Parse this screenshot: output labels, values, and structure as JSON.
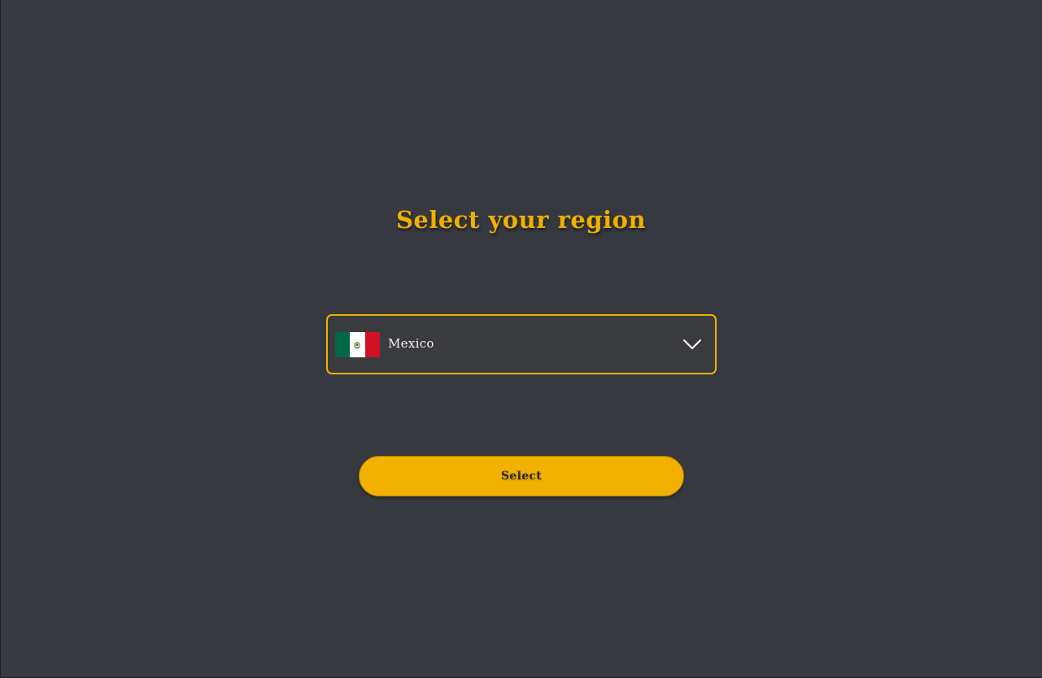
{
  "page": {
    "title": "Select your region"
  },
  "region_select": {
    "selected_country": "Mexico",
    "selected_flag": "mexico-flag-icon",
    "dropdown_icon": "chevron-down-icon"
  },
  "actions": {
    "select_label": "Select"
  },
  "colors": {
    "background": "#363940",
    "accent": "#f0b000",
    "dropdown_bg": "#3a3b3e",
    "text_light": "#f2f2f2",
    "button_text": "#2b2a28"
  }
}
